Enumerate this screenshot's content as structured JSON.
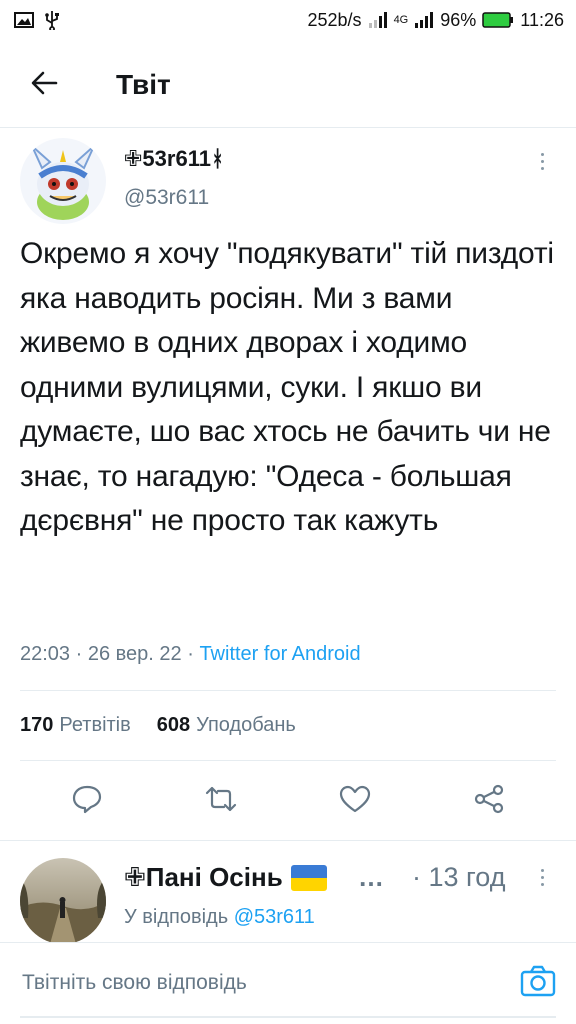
{
  "status_bar": {
    "speed": "252b/s",
    "network": "4G",
    "battery": "96%",
    "time": "11:26",
    "icons": [
      "image-icon",
      "usb-icon",
      "signal-icon",
      "signal-4g-icon",
      "battery-icon"
    ]
  },
  "header": {
    "title": "Твіт",
    "back_icon": "arrow-left-icon"
  },
  "tweet": {
    "author_name": "✙53r611ᚼ",
    "author_handle": "@53r611",
    "text": "Окремо я хочу \"подякувати\" тій пиздоті яка наводить росіян. Ми з вами живемо в одних дворах і ходимо одними вулицями, суки. І якшо ви думаєте, шо вас хтось не бачить чи не знає, то нагадую: \"Одеса - большая дєрєвня\" не просто так кажуть",
    "time": "22:03",
    "date": "26 вер. 22",
    "separator": " · ",
    "source": "Twitter for Android",
    "retweets_count": "170",
    "retweets_label": "Ретвітів",
    "likes_count": "608",
    "likes_label": "Уподобань",
    "actions": [
      "reply-icon",
      "retweet-icon",
      "like-icon",
      "share-icon"
    ]
  },
  "reply": {
    "author_name": "✙Пані Осінь",
    "ellipsis": "…",
    "time_separator": "·",
    "time": "13 год",
    "reply_to_label": "У відповідь",
    "reply_to_handle": "@53r611"
  },
  "composer": {
    "placeholder": "Твітніть свою відповідь",
    "camera_icon": "camera-icon"
  },
  "colors": {
    "accent": "#1da1f2",
    "secondary_text": "#657786",
    "divider": "#e6ecf0"
  }
}
